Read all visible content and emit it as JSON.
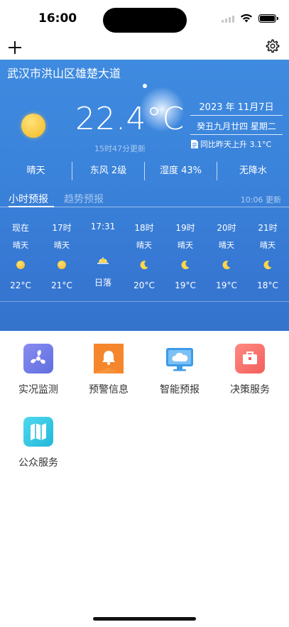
{
  "status_bar": {
    "time": "16:00"
  },
  "weather": {
    "location": "武汉市洪山区雄楚大道",
    "temperature": "22.4°C",
    "update_time": "15时47分更新",
    "date": "2023 年 11月7日",
    "lunar_date": "癸丑九月廿四 星期二",
    "comparison": "同比昨天上升 3.1°C",
    "current_icon": "sun-icon",
    "stats": [
      "晴天",
      "东风 2级",
      "湿度 43%",
      "无降水"
    ]
  },
  "forecast_tabs": {
    "tabs": [
      "小时预报",
      "趋势预报"
    ],
    "active": "小时预报",
    "update_time": "10:06 更新"
  },
  "hourly": [
    {
      "time": "现在",
      "weather": "晴天",
      "icon": "sun-icon",
      "temp": "22°C"
    },
    {
      "time": "17时",
      "weather": "晴天",
      "icon": "sun-icon",
      "temp": "21°C"
    },
    {
      "time": "17:31",
      "weather": "",
      "icon": "sunset-icon",
      "temp": "日落"
    },
    {
      "time": "18时",
      "weather": "晴天",
      "icon": "moon-icon",
      "temp": "20°C"
    },
    {
      "time": "19时",
      "weather": "晴天",
      "icon": "moon-icon",
      "temp": "19°C"
    },
    {
      "time": "20时",
      "weather": "晴天",
      "icon": "moon-icon",
      "temp": "19°C"
    },
    {
      "time": "21时",
      "weather": "晴天",
      "icon": "moon-icon",
      "temp": "18°C"
    }
  ],
  "services": [
    {
      "label": "实况监测",
      "icon": "fan-icon",
      "color": "#6b74e6"
    },
    {
      "label": "预警信息",
      "icon": "bell-icon",
      "color": "#f5862c"
    },
    {
      "label": "智能预报",
      "icon": "monitor-cloud-icon",
      "color": "#3d9be9"
    },
    {
      "label": "决策服务",
      "icon": "briefcase-icon",
      "color": "#f25f5c"
    },
    {
      "label": "公众服务",
      "icon": "map-icon",
      "color": "#22b8d9"
    }
  ]
}
